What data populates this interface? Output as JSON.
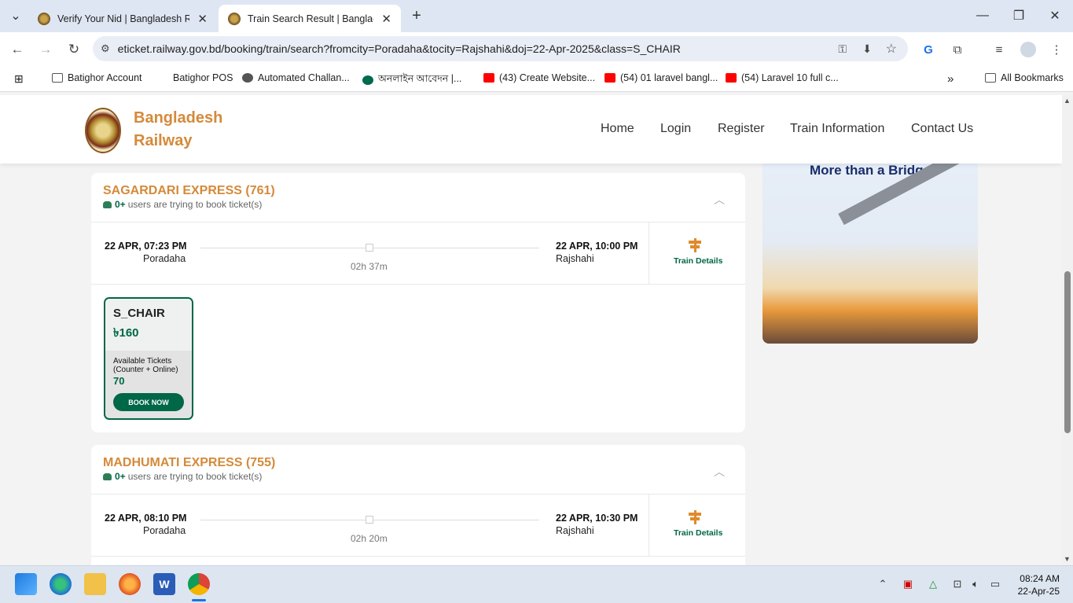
{
  "browser": {
    "tabs": [
      {
        "title": "Verify Your Nid | Bangladesh Ra"
      },
      {
        "title": "Train Search Result | Bangladesh"
      }
    ],
    "url": "eticket.railway.gov.bd/booking/train/search?fromcity=Poradaha&tocity=Rajshahi&doj=22-Apr-2025&class=S_CHAIR",
    "bookmarks": [
      {
        "label": "Batighor Account",
        "icon": "folder-icon"
      },
      {
        "label": "Batighor POS",
        "icon": "none"
      },
      {
        "label": "Automated Challan...",
        "icon": "globe-icon"
      },
      {
        "label": "অনলাইন আবেদন |...",
        "icon": "bd-flag-icon"
      },
      {
        "label": "(43) Create Website...",
        "icon": "youtube-icon"
      },
      {
        "label": "(54) 01 laravel bangl...",
        "icon": "youtube-icon"
      },
      {
        "label": "(54) Laravel 10 full c...",
        "icon": "youtube-icon"
      }
    ],
    "more_bookmarks": "»",
    "all_bookmarks": "All Bookmarks"
  },
  "site": {
    "brand_line1": "Bangladesh",
    "brand_line2": "Railway",
    "menu": [
      "Home",
      "Login",
      "Register",
      "Train Information",
      "Contact Us"
    ]
  },
  "trains": [
    {
      "name": "SAGARDARI EXPRESS (761)",
      "users_count": "0+",
      "users_text": "users are trying to book ticket(s)",
      "dep_time": "22 APR, 07:23 PM",
      "dep_station": "Poradaha",
      "arr_time": "22 APR, 10:00 PM",
      "arr_station": "Rajshahi",
      "duration": "02h 37m",
      "details_label": "Train Details",
      "seat": {
        "class": "S_CHAIR",
        "fare": "৳160",
        "avail_label": "Available Tickets (Counter + Online)",
        "count": "70",
        "book_label": "BOOK NOW"
      }
    },
    {
      "name": "MADHUMATI EXPRESS (755)",
      "users_count": "0+",
      "users_text": "users are trying to book ticket(s)",
      "dep_time": "22 APR, 08:10 PM",
      "dep_station": "Poradaha",
      "arr_time": "22 APR, 10:30 PM",
      "arr_station": "Rajshahi",
      "duration": "02h 20m",
      "details_label": "Train Details"
    }
  ],
  "ad": {
    "title": "More than a Bridge"
  },
  "taskbar": {
    "time": "08:24 AM",
    "date": "22-Apr-25"
  }
}
